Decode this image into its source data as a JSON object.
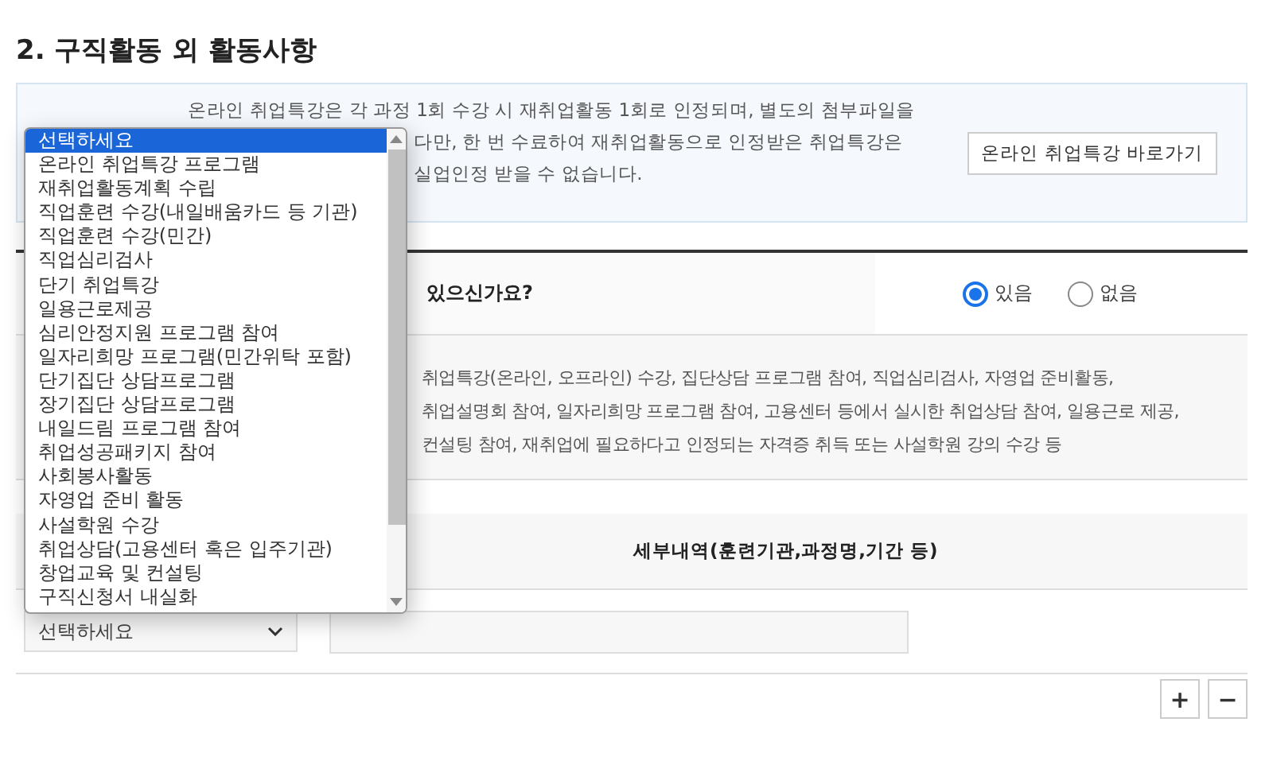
{
  "section_title": "2. 구직활동 외 활동사항",
  "notice": {
    "lines": [
      "온라인 취업특강은 각 과정 1회 수강 시 재취업활동 1회로 인정되며, 별도의 첨부파일을",
      "다만, 한 번 수료하여 재취업활동으로 인정받은 취업특강은",
      "실업인정 받을 수 없습니다."
    ],
    "button": "온라인 취업특강 바로가기"
  },
  "question": {
    "text": "있으신가요?",
    "options": [
      {
        "label": "있음",
        "selected": true
      },
      {
        "label": "없음",
        "selected": false
      }
    ]
  },
  "description_lines": [
    "취업특강(온라인, 오프라인) 수강, 집단상담 프로그램 참여, 직업심리검사, 자영업 준비활동,",
    "취업설명회 참여, 일자리희망 프로그램 참여, 고용센터 등에서 실시한 취업상담 참여, 일용근로 제공,",
    "컨설팅 참여, 재취업에 필요하다고 인정되는 자격증 취득 또는 사설학원 강의 수강 등"
  ],
  "table": {
    "column_2": "세부내역(훈련기관,과정명,기간 등)",
    "row": {
      "select_value": "선택하세요"
    }
  },
  "row_buttons": [
    "+",
    "−"
  ],
  "dropdown": {
    "options": [
      {
        "label": "선택하세요",
        "selected": true
      },
      {
        "label": "온라인 취업특강 프로그램",
        "selected": false
      },
      {
        "label": "재취업활동계획 수립",
        "selected": false
      },
      {
        "label": "직업훈련 수강(내일배움카드 등 기관)",
        "selected": false
      },
      {
        "label": "직업훈련 수강(민간)",
        "selected": false
      },
      {
        "label": "직업심리검사",
        "selected": false
      },
      {
        "label": "단기 취업특강",
        "selected": false
      },
      {
        "label": "일용근로제공",
        "selected": false
      },
      {
        "label": "심리안정지원 프로그램 참여",
        "selected": false
      },
      {
        "label": "일자리희망 프로그램(민간위탁 포함)",
        "selected": false
      },
      {
        "label": "단기집단 상담프로그램",
        "selected": false
      },
      {
        "label": "장기집단 상담프로그램",
        "selected": false
      },
      {
        "label": "내일드림 프로그램 참여",
        "selected": false
      },
      {
        "label": "취업성공패키지 참여",
        "selected": false
      },
      {
        "label": "사회봉사활동",
        "selected": false
      },
      {
        "label": "자영업 준비 활동",
        "selected": false
      },
      {
        "label": "사설학원 수강",
        "selected": false
      },
      {
        "label": "취업상담(고용센터 혹은 입주기관)",
        "selected": false
      },
      {
        "label": "창업교육 및 컨설팅",
        "selected": false
      },
      {
        "label": "구직신청서 내실화",
        "selected": false
      }
    ]
  }
}
